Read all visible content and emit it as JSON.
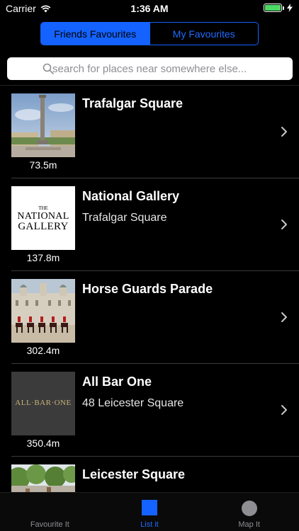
{
  "status_bar": {
    "carrier": "Carrier",
    "time": "1:36 AM"
  },
  "segments": [
    {
      "label": "Friends Favourites",
      "selected": true
    },
    {
      "label": "My Favourites",
      "selected": false
    }
  ],
  "search": {
    "placeholder": "search for places near somewhere else...",
    "value": ""
  },
  "places": [
    {
      "title": "Trafalgar Square",
      "subtitle": "",
      "distance": "73.5m",
      "thumb": "trafalgar-photo"
    },
    {
      "title": "National Gallery",
      "subtitle": "Trafalgar Square",
      "distance": "137.8m",
      "thumb": "national-gallery-logo",
      "logo_text": [
        "THE",
        "NATIONAL",
        "GALLERY"
      ]
    },
    {
      "title": "Horse Guards Parade",
      "subtitle": "",
      "distance": "302.4m",
      "thumb": "horse-guards-photo"
    },
    {
      "title": "All Bar One",
      "subtitle": "48 Leicester Square",
      "distance": "350.4m",
      "thumb": "all-bar-one-logo",
      "logo_text": "ALL·BAR·ONE"
    },
    {
      "title": "Leicester Square",
      "subtitle": "",
      "distance": "",
      "thumb": "leicester-photo"
    }
  ],
  "tabs": [
    {
      "label": "Favourite It",
      "icon": "heart-icon",
      "active": false
    },
    {
      "label": "List it",
      "icon": "list-square-icon",
      "active": true
    },
    {
      "label": "Map It",
      "icon": "map-circle-icon",
      "active": false
    }
  ],
  "colors": {
    "accent": "#1462ff",
    "battery": "#4cd964",
    "background": "#000000"
  }
}
